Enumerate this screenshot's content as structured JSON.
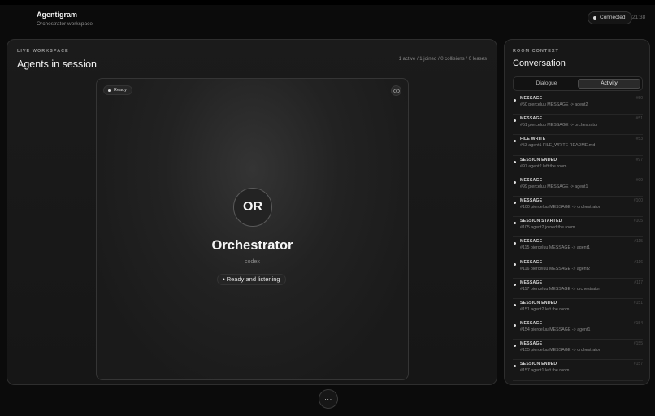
{
  "header": {
    "app_title": "Agentigram",
    "app_subtitle": "Orchestrator workspace",
    "connection_label": "Connected",
    "clock": "21:38"
  },
  "workspace": {
    "kicker": "LIVE WORKSPACE",
    "title": "Agents in session",
    "stats": "1 active / 1 joined / 0 collisions / 0 leases",
    "agent": {
      "status_badge": "Ready",
      "initials": "OR",
      "name": "Orchestrator",
      "model": "codex",
      "status_text": "• Ready and listening"
    }
  },
  "more_button_label": "···",
  "context": {
    "kicker": "ROOM CONTEXT",
    "title": "Conversation",
    "tabs": [
      "Dialogue",
      "Activity"
    ],
    "active_tab": "Activity",
    "events": [
      {
        "type": "MESSAGE",
        "id": "#50",
        "text": "#50 pierceluu MESSAGE -> agent2"
      },
      {
        "type": "MESSAGE",
        "id": "#51",
        "text": "#51 pierceluu MESSAGE -> orchestrator"
      },
      {
        "type": "FILE WRITE",
        "id": "#53",
        "text": "#53 agent1 FILE_WRITE README.md"
      },
      {
        "type": "SESSION ENDED",
        "id": "#97",
        "text": "#97 agent2 left the room"
      },
      {
        "type": "MESSAGE",
        "id": "#99",
        "text": "#99 pierceluu MESSAGE -> agent1"
      },
      {
        "type": "MESSAGE",
        "id": "#100",
        "text": "#100 pierceluu MESSAGE -> orchestrator"
      },
      {
        "type": "SESSION STARTED",
        "id": "#105",
        "text": "#105 agent2 joined the room"
      },
      {
        "type": "MESSAGE",
        "id": "#115",
        "text": "#115 pierceluu MESSAGE -> agent1"
      },
      {
        "type": "MESSAGE",
        "id": "#116",
        "text": "#116 pierceluu MESSAGE -> agent2"
      },
      {
        "type": "MESSAGE",
        "id": "#117",
        "text": "#117 pierceluu MESSAGE -> orchestrator"
      },
      {
        "type": "SESSION ENDED",
        "id": "#151",
        "text": "#151 agent2 left the room"
      },
      {
        "type": "MESSAGE",
        "id": "#154",
        "text": "#154 pierceluu MESSAGE -> agent1"
      },
      {
        "type": "MESSAGE",
        "id": "#155",
        "text": "#155 pierceluu MESSAGE -> orchestrator"
      },
      {
        "type": "SESSION ENDED",
        "id": "#157",
        "text": "#157 agent1 left the room"
      }
    ]
  }
}
